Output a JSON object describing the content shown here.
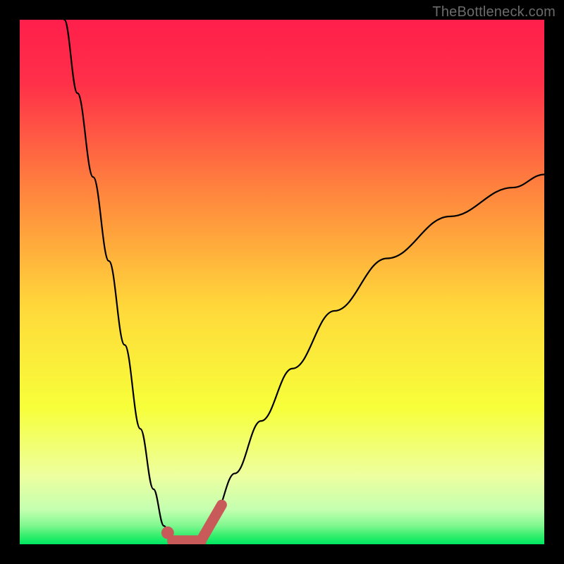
{
  "watermark": "TheBottleneck.com",
  "colors": {
    "frame": "#000000",
    "gradient_top": "#ff1f4b",
    "gradient_mid_upper": "#ff823e",
    "gradient_mid": "#ffd93a",
    "gradient_mid_lower": "#f7ff3a",
    "gradient_soft": "#e6ff8a",
    "gradient_green": "#2fee6a",
    "gradient_bottom": "#00e763",
    "curve": "#000000",
    "highlight": "#c85a5a"
  },
  "chart_data": {
    "type": "line",
    "title": "",
    "xlabel": "",
    "ylabel": "",
    "xlim": [
      0,
      1
    ],
    "ylim": [
      0,
      1
    ],
    "note": "Axes are unlabeled; x and y normalized 0–1 within plot area. y measures curve height from bottom (0) to top (1). Two branches of a cusp-like curve meeting near x≈0.30 at the bottom.",
    "series": [
      {
        "name": "left-branch",
        "x": [
          0.085,
          0.11,
          0.14,
          0.17,
          0.2,
          0.23,
          0.255,
          0.275,
          0.29
        ],
        "y": [
          1.0,
          0.86,
          0.7,
          0.54,
          0.38,
          0.22,
          0.105,
          0.035,
          0.005
        ]
      },
      {
        "name": "right-branch",
        "x": [
          0.34,
          0.37,
          0.41,
          0.46,
          0.52,
          0.6,
          0.7,
          0.82,
          0.94,
          1.0
        ],
        "y": [
          0.005,
          0.055,
          0.135,
          0.235,
          0.335,
          0.445,
          0.545,
          0.625,
          0.68,
          0.705
        ]
      }
    ],
    "bottom_plateau": {
      "x": [
        0.29,
        0.34
      ],
      "y": [
        0.004,
        0.004
      ]
    },
    "highlight_segments": [
      {
        "name": "left-blob",
        "cx": 0.282,
        "cy": 0.022,
        "r": 0.012
      },
      {
        "name": "plateau",
        "x0": 0.292,
        "x1": 0.345,
        "y": 0.006,
        "thickness": 0.022
      },
      {
        "name": "right-tail",
        "x0": 0.345,
        "x1": 0.385,
        "y0": 0.006,
        "y1": 0.075,
        "thickness": 0.02
      }
    ]
  }
}
